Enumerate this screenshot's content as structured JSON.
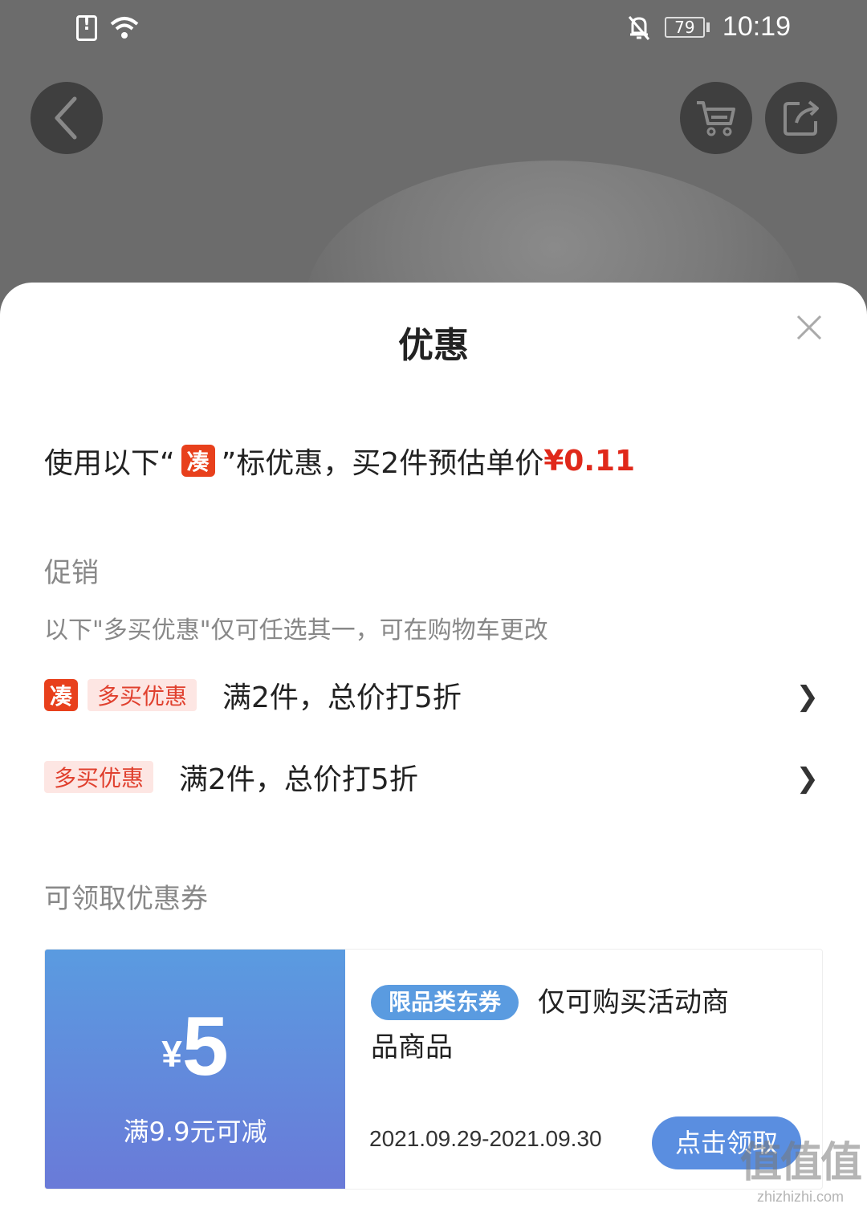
{
  "status_bar": {
    "battery": "79",
    "time": "10:19"
  },
  "sheet": {
    "title": "优惠",
    "summary": {
      "prefix": "使用以下“",
      "tag": "凑",
      "middle": "”标优惠，买2件预估单价",
      "price": "¥0.11"
    },
    "promotions": {
      "section_title": "促销",
      "note": "以下\"多买优惠\"仅可任选其一，可在购物车更改",
      "items": [
        {
          "tag": "多买优惠",
          "cou_tag": "凑",
          "text": "满2件，总价打5折"
        },
        {
          "tag": "多买优惠",
          "text": "满2件，总价打5折"
        }
      ]
    },
    "coupons": {
      "section_title": "可领取优惠券",
      "item": {
        "currency": "¥",
        "amount": "5",
        "condition": "满9.9元可减",
        "category_tag": "限品类东券",
        "desc_line1": "仅可购买活动商",
        "desc_line2": "品商品",
        "dates": "2021.09.29-2021.09.30",
        "claim_label": "点击领取"
      }
    }
  },
  "watermark": {
    "text": "值值值",
    "url": "zhizhizhi.com"
  },
  "colors": {
    "accent_red": "#e0281a",
    "coupon_blue": "#5a9be0"
  }
}
